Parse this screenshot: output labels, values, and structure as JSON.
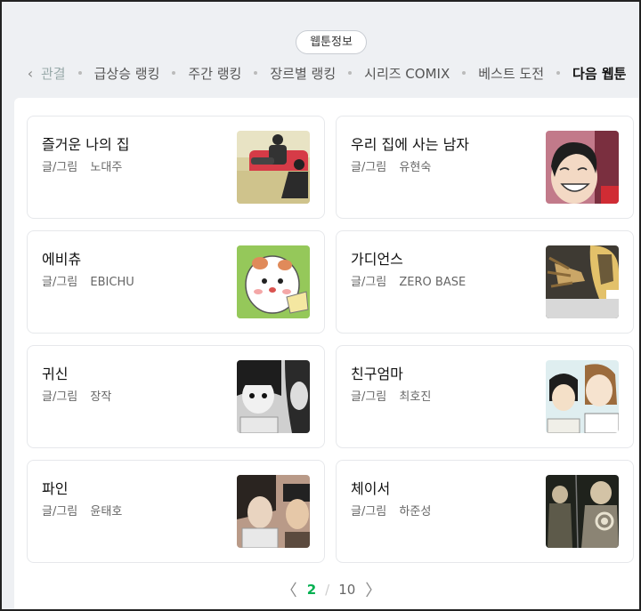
{
  "badge": "웹툰정보",
  "tabs": [
    {
      "label": "관결",
      "state": "faded"
    },
    {
      "label": "급상승 랭킹",
      "state": ""
    },
    {
      "label": "주간 랭킹",
      "state": ""
    },
    {
      "label": "장르별 랭킹",
      "state": ""
    },
    {
      "label": "시리즈 COMIX",
      "state": ""
    },
    {
      "label": "베스트 도전",
      "state": ""
    },
    {
      "label": "다음 웹툰",
      "state": "active"
    }
  ],
  "author_label": "글/그림",
  "cards": [
    {
      "title": "즐거운 나의 집",
      "author": "노대주",
      "thumb": "sofa-couple"
    },
    {
      "title": "우리 집에 사는 남자",
      "author": "유현숙",
      "thumb": "laughing-woman"
    },
    {
      "title": "에비츄",
      "author": "EBICHU",
      "thumb": "hamster"
    },
    {
      "title": "가디언스",
      "author": "ZERO BASE",
      "thumb": "clawed-hand"
    },
    {
      "title": "귀신",
      "author": "장작",
      "thumb": "two-girls"
    },
    {
      "title": "친구엄마",
      "author": "최호진",
      "thumb": "mother-and-girl"
    },
    {
      "title": "파인",
      "author": "윤태호",
      "thumb": "two-men"
    },
    {
      "title": "체이서",
      "author": "하준성",
      "thumb": "armored-figures"
    }
  ],
  "pager": {
    "current": "2",
    "separator": "/",
    "total": "10",
    "prev": "〈",
    "next": "〉"
  },
  "colors": {
    "accent": "#00b050",
    "background": "#eef0f3"
  }
}
